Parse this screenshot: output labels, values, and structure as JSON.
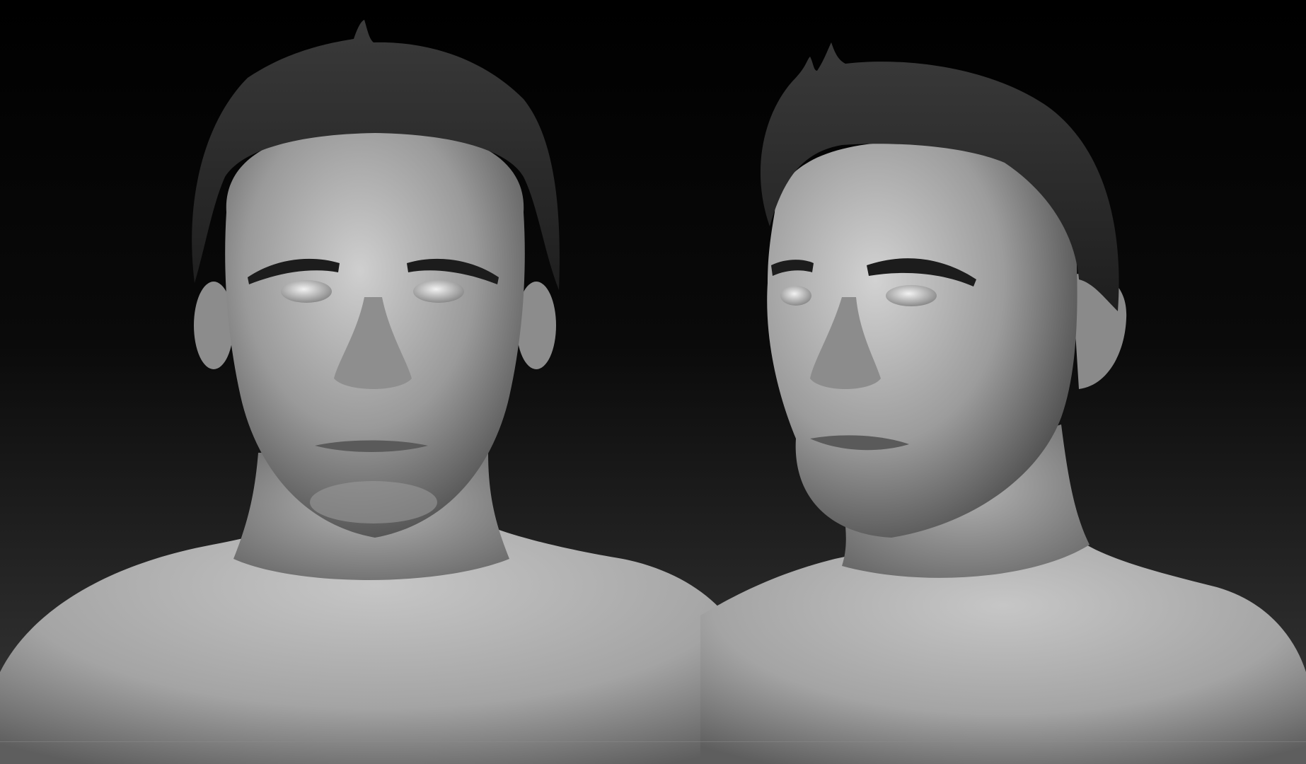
{
  "viewport": {
    "background_top": "#000000",
    "background_bottom": "#3a3a3a",
    "clay_color": "#a8a8a8",
    "hair_color": "#2a2a2a"
  },
  "renders": [
    {
      "view": "front"
    },
    {
      "view": "three-quarter"
    }
  ]
}
